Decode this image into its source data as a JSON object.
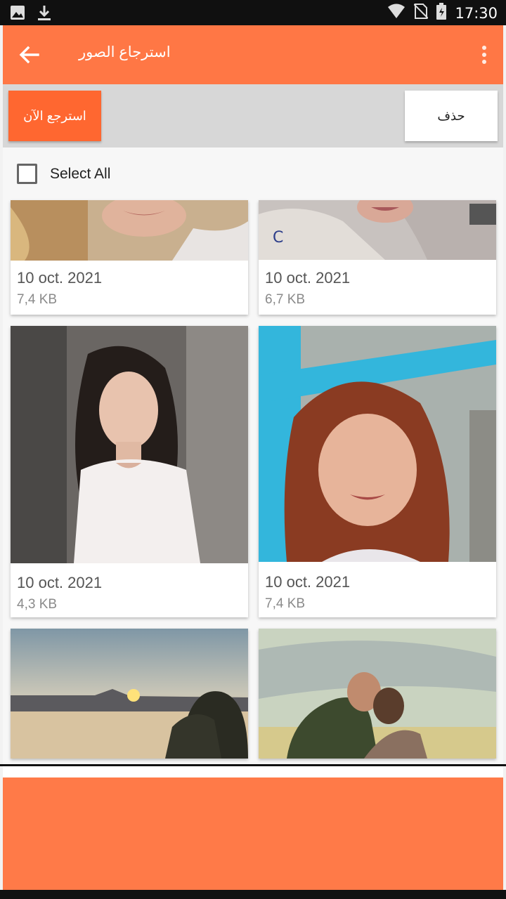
{
  "status_bar": {
    "time": "17:30",
    "icons": [
      "image-icon",
      "download-icon",
      "wifi-icon",
      "no-sim-icon",
      "battery-icon"
    ]
  },
  "app_bar": {
    "title": "استرجاع الصور",
    "back_icon": "arrow-back-icon",
    "menu_icon": "more-vert-icon",
    "color": "#ff7745"
  },
  "actions": {
    "restore_label": "استرجع الآن",
    "delete_label": "حذف",
    "restore_color": "#ff6730"
  },
  "select_all": {
    "label": "Select All",
    "checked": false
  },
  "photos": [
    {
      "date": "10 oct. 2021",
      "size": "7,4 KB"
    },
    {
      "date": "10 oct. 2021",
      "size": "6,7 KB"
    },
    {
      "date": "10 oct. 2021",
      "size": "4,3 KB"
    },
    {
      "date": "10 oct. 2021",
      "size": "7,4 KB"
    }
  ]
}
